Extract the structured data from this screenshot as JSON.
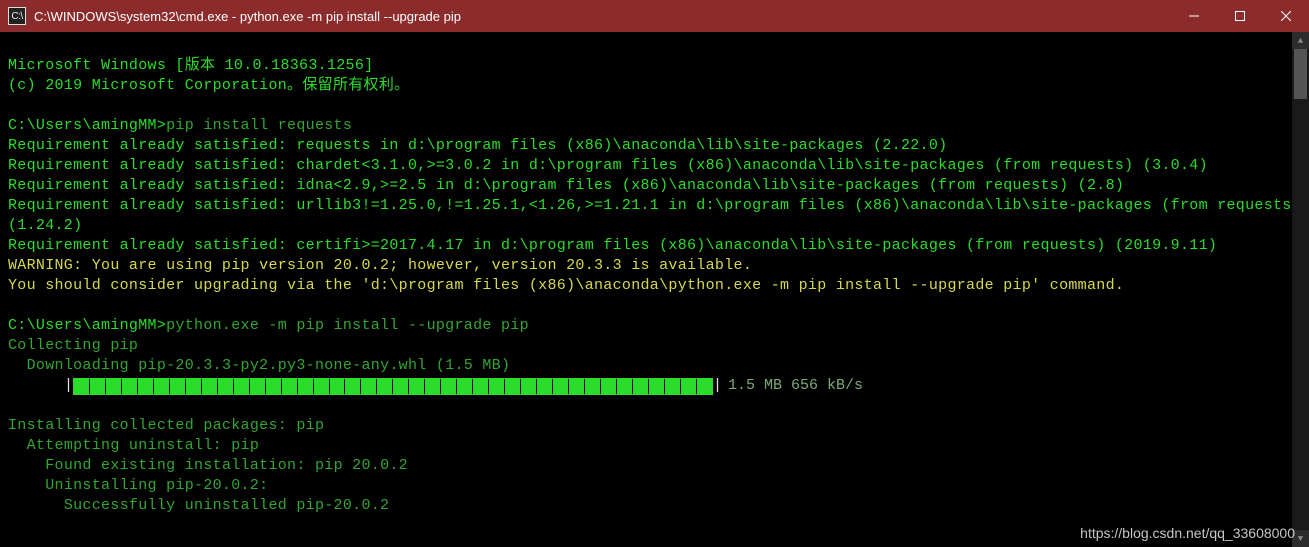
{
  "window": {
    "icon_label": "C:\\",
    "title": "C:\\WINDOWS\\system32\\cmd.exe - python.exe  -m pip install --upgrade pip"
  },
  "term": {
    "banner_version": "Microsoft Windows [版本 10.0.18363.1256]",
    "banner_copyright": "(c) 2019 Microsoft Corporation。保留所有权利。",
    "prompt1": "C:\\Users\\amingMM>",
    "cmd1": "pip install requests",
    "req1": "Requirement already satisfied: requests in d:\\program files (x86)\\anaconda\\lib\\site-packages (2.22.0)",
    "req2": "Requirement already satisfied: chardet<3.1.0,>=3.0.2 in d:\\program files (x86)\\anaconda\\lib\\site-packages (from requests) (3.0.4)",
    "req3": "Requirement already satisfied: idna<2.9,>=2.5 in d:\\program files (x86)\\anaconda\\lib\\site-packages (from requests) (2.8)",
    "req4": "Requirement already satisfied: urllib3!=1.25.0,!=1.25.1,<1.26,>=1.21.1 in d:\\program files (x86)\\anaconda\\lib\\site-packages (from requests) (1.24.2)",
    "req5": "Requirement already satisfied: certifi>=2017.4.17 in d:\\program files (x86)\\anaconda\\lib\\site-packages (from requests) (2019.9.11)",
    "warn1": "WARNING: You are using pip version 20.0.2; however, version 20.3.3 is available.",
    "warn2": "You should consider upgrading via the 'd:\\program files (x86)\\anaconda\\python.exe -m pip install --upgrade pip' command.",
    "prompt2": "C:\\Users\\amingMM>",
    "cmd2": "python.exe -m pip install --upgrade pip",
    "collecting": "Collecting pip",
    "downloading": "  Downloading pip-20.3.3-py2.py3-none-any.whl (1.5 MB)",
    "progress_pipe": "|",
    "progress_rest": " 1.5 MB 656 kB/s",
    "installing": "Installing collected packages: pip",
    "attempt_uninstall": "  Attempting uninstall: pip",
    "found_existing": "    Found existing installation: pip 20.0.2",
    "uninstalling": "    Uninstalling pip-20.0.2:",
    "success_uninstall": "      Successfully uninstalled pip-20.0.2"
  },
  "progress": {
    "cells": 40
  },
  "watermark": "https://blog.csdn.net/qq_33608000"
}
